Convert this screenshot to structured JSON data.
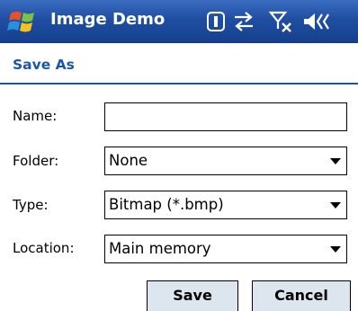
{
  "titlebar": {
    "app_title": "Image Demo",
    "icons": [
      "windows-start-icon",
      "battery-icon",
      "sync-icon",
      "signal-off-icon",
      "volume-icon"
    ]
  },
  "dialog": {
    "title": "Save As",
    "fields": {
      "name": {
        "label": "Name:",
        "value": ""
      },
      "folder": {
        "label": "Folder:",
        "value": "None"
      },
      "type": {
        "label": "Type:",
        "value": "Bitmap (*.bmp)"
      },
      "location": {
        "label": "Location:",
        "value": "Main memory"
      }
    },
    "buttons": {
      "save": "Save",
      "cancel": "Cancel"
    }
  },
  "colors": {
    "titlebar": "#1f4ea1",
    "accent": "#1a56a8"
  }
}
